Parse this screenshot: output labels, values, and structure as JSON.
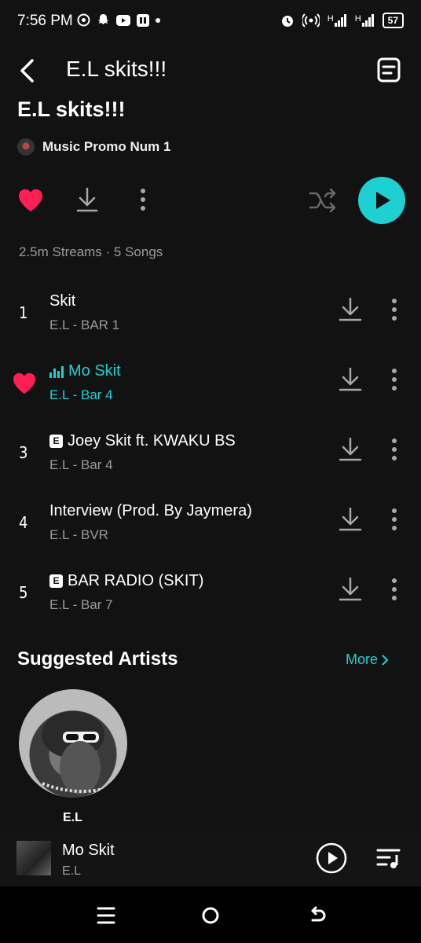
{
  "status_bar": {
    "time": "7:56 PM",
    "battery": "57",
    "left_icons": [
      "whatsapp-icon",
      "snapchat-icon",
      "youtube-icon",
      "app-icon",
      "dot"
    ],
    "right_icons": [
      "alarm-icon",
      "hotspot-icon",
      "signal-1-icon",
      "signal-2-icon",
      "battery-icon"
    ],
    "signal_label_1": "H",
    "signal_label_2": "H"
  },
  "header": {
    "title": "E.L skits!!!"
  },
  "playlist": {
    "title": "E.L skits!!!",
    "owner": "Music Promo Num 1",
    "stats": "2.5m Streams · 5 Songs",
    "liked": true
  },
  "tracks": [
    {
      "num": "1",
      "title": "Skit",
      "sub": "E.L - BAR 1",
      "explicit": false,
      "active": false
    },
    {
      "num": "",
      "title": "Mo Skit",
      "sub": "E.L - Bar 4",
      "explicit": false,
      "active": true,
      "liked": true
    },
    {
      "num": "3",
      "title": "Joey Skit ft. KWAKU BS",
      "sub": "E.L - Bar 4",
      "explicit": true,
      "active": false
    },
    {
      "num": "4",
      "title": "Interview (Prod. By Jaymera)",
      "sub": "E.L - BVR",
      "explicit": false,
      "active": false
    },
    {
      "num": "5",
      "title": "BAR RADIO (SKIT)",
      "sub": "E.L - Bar 7",
      "explicit": true,
      "active": false
    }
  ],
  "explicit_badge": "E",
  "suggested": {
    "title": "Suggested Artists",
    "more_label": "More",
    "artists": [
      {
        "name": "E.L"
      }
    ]
  },
  "mini_player": {
    "title": "Mo Skit",
    "artist": "E.L"
  },
  "colors": {
    "accent": "#1fd0d3",
    "heart": "#ff1f55",
    "background": "#121212",
    "muted": "#9b9b9b"
  }
}
